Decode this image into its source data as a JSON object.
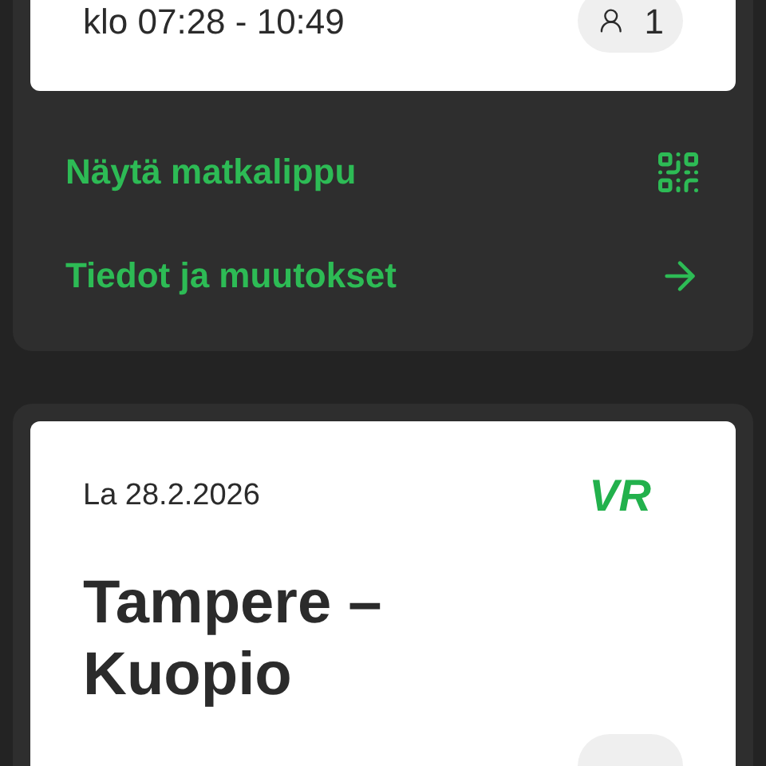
{
  "trips": [
    {
      "time": "klo 07:28 - 10:49",
      "passengers": "1",
      "actions": [
        {
          "label": "Näytä matkalippu",
          "kind": "ticket"
        },
        {
          "label": "Tiedot ja muutokset",
          "kind": "details"
        }
      ]
    },
    {
      "date": "La 28.2.2026",
      "logo": "VR",
      "route": "Tampere – Kuopio"
    }
  ]
}
